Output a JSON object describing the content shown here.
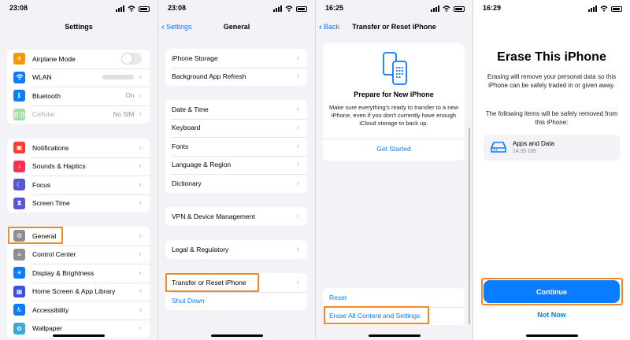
{
  "panel1": {
    "time": "23:08",
    "title": "Settings",
    "group1": [
      {
        "label": "Airplane Mode",
        "icon": "airplane-icon",
        "color": "#ff9500",
        "control": "toggle"
      },
      {
        "label": "WLAN",
        "icon": "wifi-icon",
        "color": "#0a7cff",
        "control": "blurred"
      },
      {
        "label": "Bluetooth",
        "icon": "bluetooth-icon",
        "color": "#0a7cff",
        "value": "On"
      },
      {
        "label": "Cellular",
        "icon": "cellular-icon",
        "color": "#9de0a8",
        "value": "No SIM",
        "dimmed": true
      }
    ],
    "group2": [
      {
        "label": "Notifications",
        "icon": "notifications-icon",
        "color": "#ff3b30"
      },
      {
        "label": "Sounds & Haptics",
        "icon": "sounds-icon",
        "color": "#ff2d55"
      },
      {
        "label": "Focus",
        "icon": "focus-moon-icon",
        "color": "#5856d6"
      },
      {
        "label": "Screen Time",
        "icon": "hourglass-icon",
        "color": "#5856d6"
      }
    ],
    "group3": [
      {
        "label": "General",
        "icon": "gear-icon",
        "color": "#8e8e93",
        "highlighted": true
      },
      {
        "label": "Control Center",
        "icon": "control-center-icon",
        "color": "#8e8e93"
      },
      {
        "label": "Display & Brightness",
        "icon": "display-icon",
        "color": "#0a7cff"
      },
      {
        "label": "Home Screen & App Library",
        "icon": "home-screen-icon",
        "color": "#3d50e0"
      },
      {
        "label": "Accessibility",
        "icon": "accessibility-icon",
        "color": "#0a7cff"
      },
      {
        "label": "Wallpaper",
        "icon": "wallpaper-icon",
        "color": "#35aadc"
      }
    ]
  },
  "panel2": {
    "time": "23:08",
    "back": "Settings",
    "title": "General",
    "group1": [
      "iPhone Storage",
      "Background App Refresh"
    ],
    "group2": [
      "Date & Time",
      "Keyboard",
      "Fonts",
      "Language & Region",
      "Dictionary"
    ],
    "group3": [
      "VPN & Device Management"
    ],
    "group4": [
      "Legal & Regulatory"
    ],
    "group5": {
      "transfer": "Transfer or Reset iPhone",
      "shutdown": "Shut Down"
    }
  },
  "panel3": {
    "time": "16:25",
    "back": "Back",
    "title": "Transfer or Reset iPhone",
    "card_title": "Prepare for New iPhone",
    "card_desc": "Make sure everything's ready to transfer to a new iPhone, even if you don't currently have enough iCloud storage to back up.",
    "get_started": "Get Started",
    "reset": "Reset",
    "erase_all": "Erase All Content and Settings"
  },
  "panel4": {
    "time": "16:29",
    "title": "Erase This iPhone",
    "desc1": "Erasing will remove your personal data so this iPhone can be safely traded in or given away.",
    "desc2": "The following items will be safely removed from this iPhone:",
    "item_label": "Apps and Data",
    "item_size": "14.95 GB",
    "continue": "Continue",
    "not_now": "Not Now"
  },
  "colors": {
    "accent": "#0a7cff",
    "highlight": "#f08a24",
    "background": "#f2f2f7"
  }
}
